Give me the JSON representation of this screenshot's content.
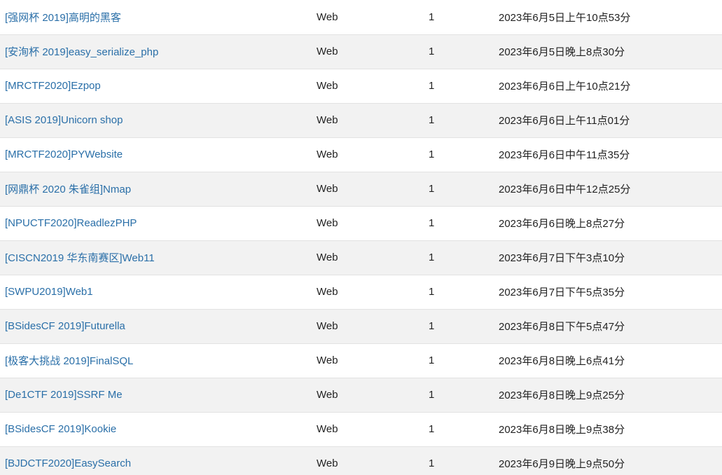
{
  "solves": [
    {
      "name": "[强网杯 2019]高明的黑客",
      "category": "Web",
      "score": "1",
      "time": "2023年6月5日上午10点53分"
    },
    {
      "name": "[安洵杯 2019]easy_serialize_php",
      "category": "Web",
      "score": "1",
      "time": "2023年6月5日晚上8点30分"
    },
    {
      "name": "[MRCTF2020]Ezpop",
      "category": "Web",
      "score": "1",
      "time": "2023年6月6日上午10点21分"
    },
    {
      "name": "[ASIS 2019]Unicorn shop",
      "category": "Web",
      "score": "1",
      "time": "2023年6月6日上午11点01分"
    },
    {
      "name": "[MRCTF2020]PYWebsite",
      "category": "Web",
      "score": "1",
      "time": "2023年6月6日中午11点35分"
    },
    {
      "name": "[网鼎杯 2020 朱雀组]Nmap",
      "category": "Web",
      "score": "1",
      "time": "2023年6月6日中午12点25分"
    },
    {
      "name": "[NPUCTF2020]ReadlezPHP",
      "category": "Web",
      "score": "1",
      "time": "2023年6月6日晚上8点27分"
    },
    {
      "name": "[CISCN2019 华东南赛区]Web11",
      "category": "Web",
      "score": "1",
      "time": "2023年6月7日下午3点10分"
    },
    {
      "name": "[SWPU2019]Web1",
      "category": "Web",
      "score": "1",
      "time": "2023年6月7日下午5点35分"
    },
    {
      "name": "[BSidesCF 2019]Futurella",
      "category": "Web",
      "score": "1",
      "time": "2023年6月8日下午5点47分"
    },
    {
      "name": "[极客大挑战 2019]FinalSQL",
      "category": "Web",
      "score": "1",
      "time": "2023年6月8日晚上6点41分"
    },
    {
      "name": "[De1CTF 2019]SSRF Me",
      "category": "Web",
      "score": "1",
      "time": "2023年6月8日晚上9点25分"
    },
    {
      "name": "[BSidesCF 2019]Kookie",
      "category": "Web",
      "score": "1",
      "time": "2023年6月8日晚上9点38分"
    },
    {
      "name": "[BJDCTF2020]EasySearch",
      "category": "Web",
      "score": "1",
      "time": "2023年6月9日晚上9点50分"
    }
  ],
  "colors": {
    "link": "#2a6fa8",
    "row_alt": "#f2f2f2",
    "border": "#e2e2e2"
  }
}
